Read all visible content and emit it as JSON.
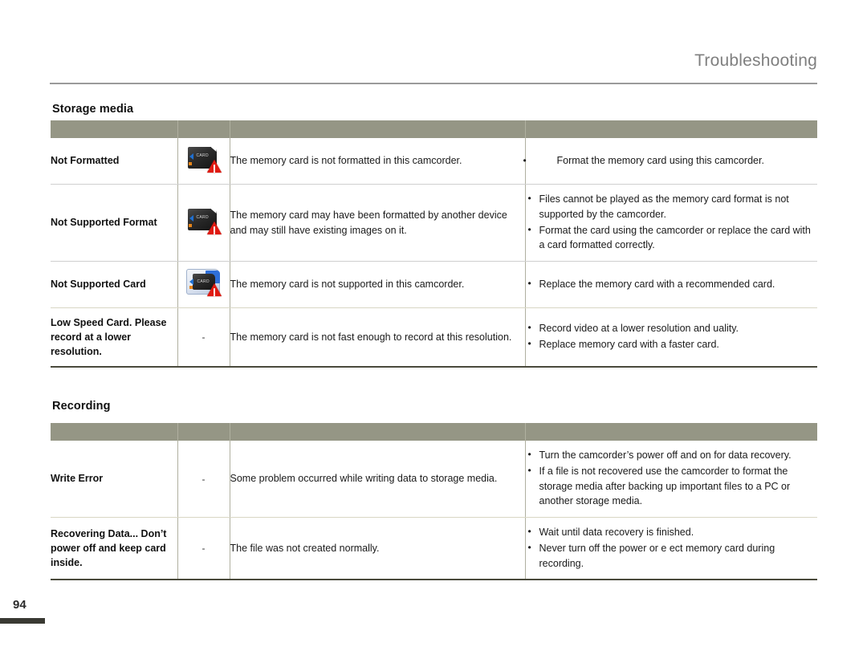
{
  "header": {
    "title": "Troubleshooting"
  },
  "sections": [
    {
      "heading": "Storage media",
      "columns": [
        "",
        "",
        "",
        ""
      ],
      "rows": [
        {
          "message": "Not Formatted",
          "icon": "memory-card-warning-icon",
          "icon_variant": "dark",
          "meaning": "The memory card is not formatted in this camcorder.",
          "actions": [
            "Format the memory card using this camcorder."
          ]
        },
        {
          "message": "Not Supported Format",
          "icon": "memory-card-warning-icon",
          "icon_variant": "dark",
          "meaning": "The memory card may have been formatted by another device and may still have existing images on it.",
          "actions": [
            "Files cannot be played as the memory card format is not supported by the camcorder.",
            "Format the card using the camcorder or replace the card with a card formatted correctly."
          ]
        },
        {
          "message": "Not Supported Card",
          "icon": "memory-card-warning-icon",
          "icon_variant": "light",
          "meaning": "The memory card is not supported in this camcorder.",
          "actions": [
            "Replace the memory card with a recommended card."
          ]
        },
        {
          "message": "Low Speed Card. Please record at a lower resolution.",
          "icon": "dash-placeholder",
          "icon_variant": "none",
          "icon_text": "-",
          "meaning": "The memory card is not fast enough to record at this resolution.",
          "actions": [
            "Record video at a lower resolution and  uality.",
            "Replace memory card with a faster card."
          ]
        }
      ]
    },
    {
      "heading": "Recording",
      "columns": [
        "",
        "",
        "",
        ""
      ],
      "rows": [
        {
          "message": "Write Error",
          "icon": "dash-placeholder",
          "icon_variant": "none",
          "icon_text": "-",
          "meaning": "Some problem occurred while writing data to storage media.",
          "actions": [
            "Turn the camcorder’s power off and on for data recovery.",
            "If a file is not recovered  use the camcorder to format the storage media after backing up important files to a PC or another storage media."
          ]
        },
        {
          "message": "Recovering Data... Don’t power off and keep card inside.",
          "icon": "dash-placeholder",
          "icon_variant": "none",
          "icon_text": "-",
          "meaning": "The file was not created normally.",
          "actions": [
            "Wait until data recovery is finished.",
            "Never turn off the power or e ect memory card during recording."
          ]
        }
      ]
    }
  ],
  "row1_action_fragment": {
    "prefix": "Format",
    "overlap": "t",
    "suffix": "he memory card using this camcorder."
  },
  "footer": {
    "page_number": "94"
  },
  "colors": {
    "header_bar": "#959685",
    "title_gray": "#7f7f7f",
    "rule_gray": "#9a9a9a",
    "table_bottom": "#4a4a3c",
    "row_divider": "#cfcfcf",
    "warning_red": "#e01b12",
    "card_blue": "#2f6fd8",
    "card_orange": "#e8861a"
  },
  "icon_labels": {
    "card_text": "CARD"
  }
}
